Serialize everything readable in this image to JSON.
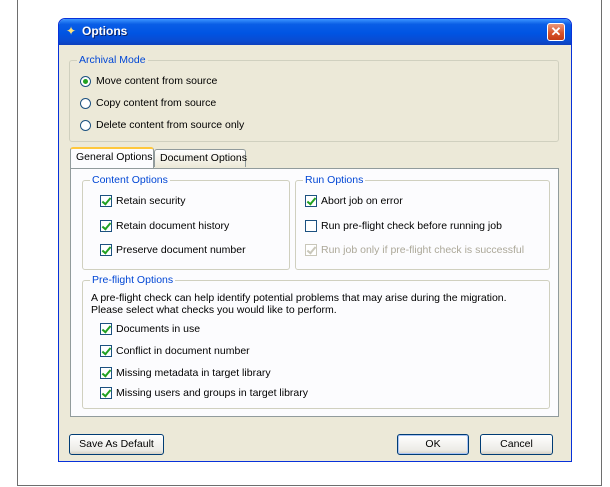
{
  "window": {
    "title": "Options",
    "close_glyph": "✕",
    "icon": "options-icon"
  },
  "archival": {
    "legend": "Archival Mode",
    "options": [
      {
        "label": "Move content from source",
        "selected": true
      },
      {
        "label": "Copy content from source",
        "selected": false
      },
      {
        "label": "Delete content from source only",
        "selected": false
      }
    ]
  },
  "tabs": [
    {
      "label": "General Options",
      "active": true
    },
    {
      "label": "Document Options",
      "active": false
    }
  ],
  "content_options": {
    "legend": "Content Options",
    "items": [
      {
        "label": "Retain security",
        "checked": true
      },
      {
        "label": "Retain document history",
        "checked": true
      },
      {
        "label": "Preserve document number",
        "checked": true
      }
    ]
  },
  "run_options": {
    "legend": "Run Options",
    "items": [
      {
        "label": "Abort job on error",
        "checked": true,
        "enabled": true
      },
      {
        "label": "Run pre-flight check before running job",
        "checked": false,
        "enabled": true
      },
      {
        "label": "Run job only if pre-flight check is successful",
        "checked": true,
        "enabled": false
      }
    ]
  },
  "preflight": {
    "legend": "Pre-flight Options",
    "description_line1": "A pre-flight check can help identify potential problems that may arise during the migration.",
    "description_line2": "Please select what checks you would like to perform.",
    "items": [
      {
        "label": "Documents in use",
        "checked": true
      },
      {
        "label": "Conflict in document number",
        "checked": true
      },
      {
        "label": "Missing metadata in target library",
        "checked": true
      },
      {
        "label": "Missing users and groups in target library",
        "checked": true
      }
    ]
  },
  "buttons": {
    "save_default": "Save As Default",
    "ok": "OK",
    "cancel": "Cancel"
  },
  "colors": {
    "title_bar": "#0054e3",
    "group_label": "#0046d5",
    "check_mark": "#21a121",
    "close_button": "#d9542b"
  }
}
